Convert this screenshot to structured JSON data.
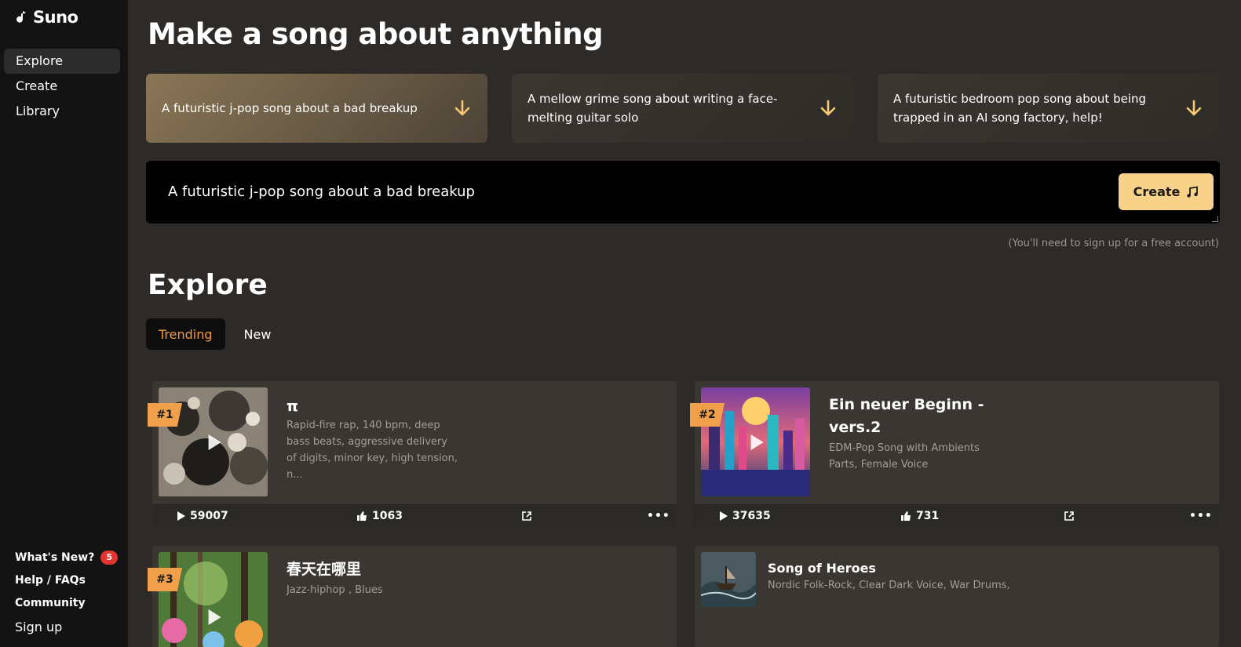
{
  "brand": {
    "name": "Suno"
  },
  "sidebar": {
    "items": [
      {
        "label": "Explore"
      },
      {
        "label": "Create"
      },
      {
        "label": "Library"
      }
    ],
    "bottom": {
      "whats_new": "What's New?",
      "whats_new_count": "5",
      "help": "Help / FAQs",
      "community": "Community",
      "signup": "Sign up"
    }
  },
  "hero": {
    "title": "Make a song about anything",
    "prompts": [
      "A futuristic j-pop song about a bad breakup",
      "A mellow grime song about writing a face-melting guitar solo",
      "A futuristic bedroom pop song about being trapped in an AI song factory, help!"
    ],
    "input_value": "A futuristic j-pop song about a bad breakup",
    "create_label": "Create",
    "signup_note": "(You'll need to sign up for a free account)"
  },
  "explore": {
    "title": "Explore",
    "tabs": [
      {
        "label": "Trending"
      },
      {
        "label": "New"
      }
    ],
    "songs": [
      {
        "rank": "#1",
        "title": "π",
        "description": "Rapid-fire rap, 140 bpm, deep bass beats, aggressive delivery of digits, minor key, high tension, n...",
        "plays": "59007",
        "likes": "1063"
      },
      {
        "rank": "#2",
        "title": "Ein neuer Beginn - vers.2",
        "description": "EDM-Pop Song with Ambients Parts, Female Voice",
        "plays": "37635",
        "likes": "731"
      },
      {
        "rank": "#3",
        "title": "春天在哪里",
        "description": "Jazz-hiphop , Blues"
      },
      {
        "title": "Song of Heroes",
        "description": "Nordic Folk-Rock, Clear Dark Voice, War Drums,"
      }
    ]
  },
  "colors": {
    "accent": "#f8d289",
    "tab_active": "#f39a3c",
    "rank_badge": "#f0a04b",
    "badge_red": "#e0362f"
  }
}
